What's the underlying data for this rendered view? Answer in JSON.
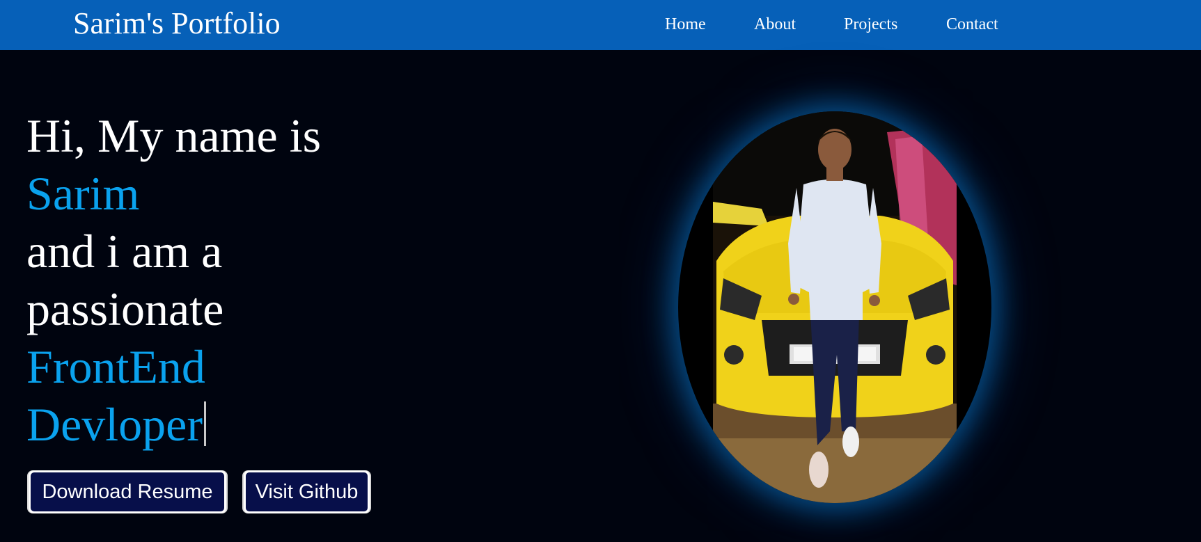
{
  "navbar": {
    "brand": "Sarim's Portfolio",
    "links": [
      {
        "label": "Home"
      },
      {
        "label": "About"
      },
      {
        "label": "Projects"
      },
      {
        "label": "Contact"
      }
    ],
    "background_color": "#0660b8"
  },
  "hero": {
    "greeting": "Hi, My name is",
    "name": "Sarim",
    "line_and": "and i am a",
    "line_passionate": "passionate",
    "role_line1": "FrontEnd",
    "role_line2": "Devloper",
    "accent_color": "#0aa2ee",
    "buttons": {
      "download_resume": "Download Resume",
      "visit_github": "Visit Github"
    },
    "photo_icon": "profile-photo"
  },
  "colors": {
    "page_background": "#00040f",
    "button_background": "#070f4a",
    "photo_glow": "#096ebe"
  }
}
